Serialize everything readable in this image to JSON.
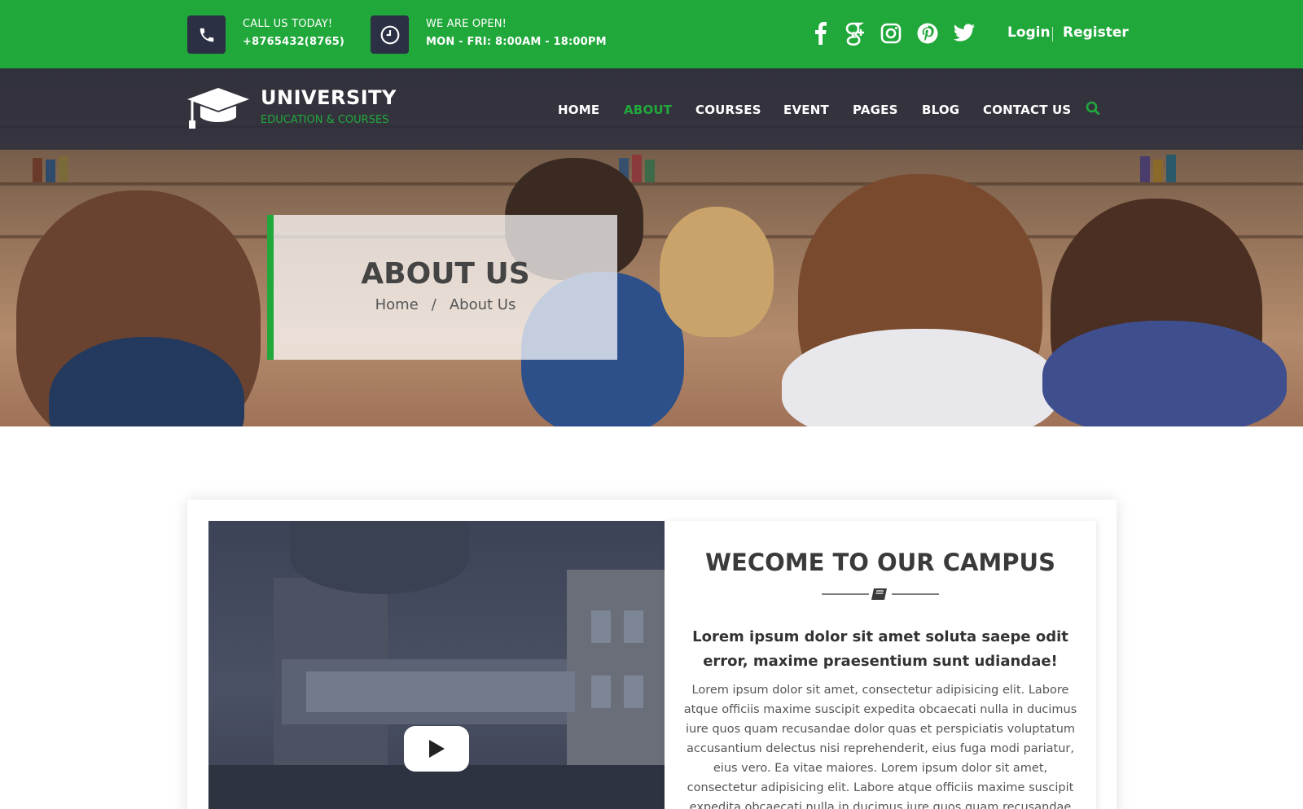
{
  "topbar": {
    "call_label": "CALL US TODAY!",
    "call_value": "+8765432(8765)",
    "hours_label": "WE ARE OPEN!",
    "hours_value": "MON - FRI: 8:00AM - 18:00PM",
    "social_icons": [
      "facebook-icon",
      "google-plus-icon",
      "instagram-icon",
      "pinterest-icon",
      "twitter-icon"
    ],
    "login_label": "Login",
    "register_label": "Register"
  },
  "header": {
    "logo_title": "UNIVERSITY",
    "logo_subtitle": "EDUCATION & COURSES",
    "nav": [
      {
        "label": "HOME",
        "active": false
      },
      {
        "label": "ABOUT",
        "active": true
      },
      {
        "label": "COURSES",
        "active": false
      },
      {
        "label": "EVENT",
        "active": false
      },
      {
        "label": "PAGES",
        "active": false
      },
      {
        "label": "BLOG",
        "active": false
      },
      {
        "label": "CONTACT US",
        "active": false
      }
    ]
  },
  "hero": {
    "title": "ABOUT US",
    "breadcrumb": [
      "Home",
      "/",
      "About Us"
    ]
  },
  "welcome": {
    "title": "WECOME TO OUR CAMPUS",
    "lead": "Lorem ipsum dolor sit amet soluta saepe odit error, maxime praesentium sunt udiandae!",
    "body": "Lorem ipsum dolor sit amet, consectetur adipisicing elit. Labore atque officiis maxime suscipit expedita obcaecati nulla in ducimus iure quos quam recusandae dolor quas et perspiciatis voluptatum accusantium delectus nisi reprehenderit, eius fuga modi pariatur, eius vero. Ea vitae maiores. Lorem ipsum dolor sit amet, consectetur adipisicing elit. Labore atque officiis maxime suscipit expedita obcaecati nulla in ducimus iure quos quam recusandae dolor quas et perspiciatis voluptatum"
  },
  "colors": {
    "brand_green": "#21a83b",
    "navy": "#2b3044",
    "heading": "#3a3a3a"
  }
}
